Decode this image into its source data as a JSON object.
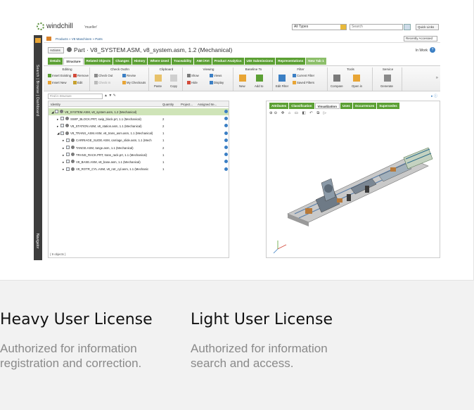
{
  "app": {
    "brand": "windchill",
    "user": "'mueller'",
    "type_filter": "All Types",
    "search_placeholder": "Search",
    "quick_links": "Quick Links",
    "rail_label": "Search | Browse | Dashboard",
    "rail_nav": "Navigator",
    "breadcrumb": "Products » V8 Maschinen » Parts",
    "recent": "Recently Accessed",
    "actions": "Actions",
    "title": "Part · V8_SYSTEM.ASM, v8_system.asm, 1.2 (Mechanical)",
    "state": "In Work",
    "tabs": [
      "Details",
      "Structure",
      "Related Objects",
      "Changes",
      "History",
      "Where Used",
      "Traceability",
      "AMI /AVI",
      "Product Analytics",
      "UDI Submissions",
      "Representations",
      "New Tab 1"
    ],
    "active_tab": "Structure",
    "ribbon": {
      "groups": [
        "Editing",
        "Check Out/In",
        "Clipboard",
        "Viewing",
        "Baseline To",
        "Filter",
        "Tools",
        "Service"
      ],
      "items": {
        "insert_existing": "Insert Existing",
        "remove": "Remove",
        "insert_new": "Insert New",
        "edit": "Edit",
        "check_out": "Check Out",
        "revise": "Revise",
        "check_in": "Check In",
        "my_checkouts": "My Checkouts",
        "paste": "Paste",
        "copy": "Copy",
        "show": "Show",
        "views": "Views",
        "hide": "Hide",
        "display": "Display",
        "new": "New",
        "add_to": "Add to",
        "edit_filter": "Edit Filter",
        "current_filter": "Current Filter",
        "saved_filters": "Saved Filters",
        "compare": "Compare",
        "open_in": "Open in",
        "generate": "Generate"
      }
    },
    "find_placeholder": "Find in Structure",
    "tree": {
      "columns": [
        "Identity",
        "Quantity",
        "Project...",
        "Assigned Ite..."
      ],
      "rows": [
        {
          "name": "V8_SYSTEM.ASM, v8_system.asm, 1.2 (Mechanical)",
          "qty": ""
        },
        {
          "name": "SWIP_BLOCK.PRT, swip_block.prt, 1.1 (Mechanical)",
          "qty": "2"
        },
        {
          "name": "V8_STATION.ASM, v8_station.asm, 1.1 (Mechanical)",
          "qty": "2"
        },
        {
          "name": "V8_TRANS_ASM.ASM, v8_trans_asm.asm, 1.1 (Mechanical)",
          "qty": "1"
        },
        {
          "name": "CARRIAGE_SLIDE.ASM, carriage_slide.asm, 1.1 (Mech",
          "qty": "1"
        },
        {
          "name": "TANGE.ASM, tange.asm, 1.1 (Mechanical)",
          "qty": "2"
        },
        {
          "name": "TRANS_RACK.PRT, trans_rack.prt, 1.1 (Mechanical)",
          "qty": "1"
        },
        {
          "name": "V8_BASE.ASM, v8_base.asm, 1.1 (Mechanical)",
          "qty": "1"
        },
        {
          "name": "V8_ROTR_CYL.ASM, v8_rotr_cyl.asm, 1.1 (Mechanic",
          "qty": "1"
        }
      ],
      "footer": "( 9 objects )"
    },
    "viewer_tabs": [
      "Attributes",
      "Classification",
      "Visualization",
      "Uses",
      "Occurrences",
      "Supersedes"
    ],
    "viewer_active": "Visualization"
  },
  "captions": [
    {
      "title": "Heavy User License",
      "desc": "Authorized for information registration and correction."
    },
    {
      "title": "Light User License",
      "desc": "Authorized for information search and access."
    }
  ],
  "colors": {
    "tab_green": "#5ca034",
    "accent_orange": "#e8a535",
    "link_blue": "#245a8f"
  }
}
